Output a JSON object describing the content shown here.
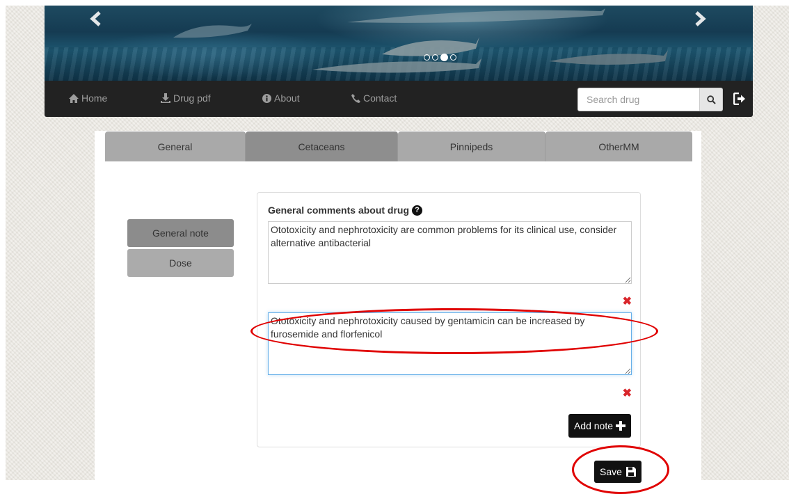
{
  "banner": {
    "prev_arrow": "prev-arrow-icon",
    "next_arrow": "next-arrow-icon",
    "slide_count": 4,
    "active_slide": 3
  },
  "nav": {
    "home": "Home",
    "drug_pdf": "Drug pdf",
    "about": "About",
    "contact": "Contact",
    "search_placeholder": "Search drug"
  },
  "tabs": [
    {
      "label": "General",
      "active": false
    },
    {
      "label": "Cetaceans",
      "active": true
    },
    {
      "label": "Pinnipeds",
      "active": false
    },
    {
      "label": "OtherMM",
      "active": false
    }
  ],
  "side_menu": [
    {
      "label": "General note",
      "active": true
    },
    {
      "label": "Dose",
      "active": false
    }
  ],
  "panel": {
    "title": "General comments about drug",
    "help": "?",
    "notes": [
      {
        "text": "Ototoxicity and nephrotoxicity are common problems for its clinical use, consider alternative antibacterial"
      },
      {
        "text": "Ototoxicity and nephrotoxicity caused by gentamicin can be increased by furosemide and florfenicol"
      }
    ],
    "remove_symbol": "✖",
    "add_note_label": "Add note"
  },
  "save_label": "Save",
  "colors": {
    "navbar": "#222222",
    "button": "#111111",
    "remove": "#d9262b",
    "annotation": "#e00000"
  }
}
